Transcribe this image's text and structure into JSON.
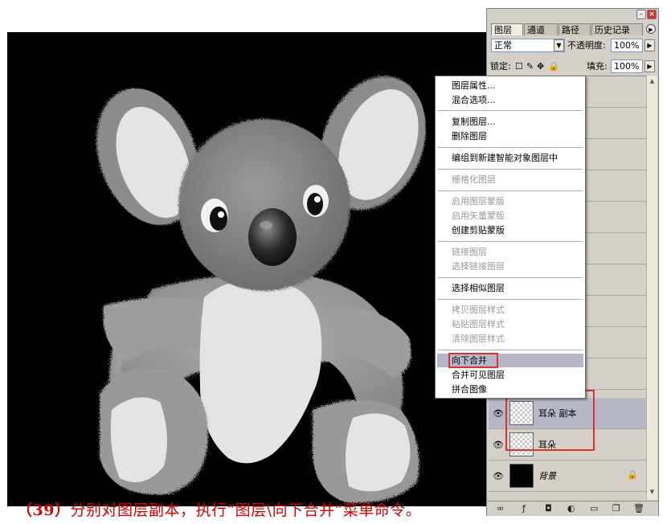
{
  "panel": {
    "tabs": [
      "图层",
      "通道",
      "路径",
      "历史记录"
    ],
    "blend_mode": "正常",
    "opacity_label": "不透明度:",
    "opacity_value": "100%",
    "lock_label": "锁定:",
    "fill_label": "填充:",
    "fill_value": "100%",
    "layers": [
      {
        "name": "耳朵 副本",
        "visible": true,
        "selected": true
      },
      {
        "name": "耳朵",
        "visible": true,
        "selected": false
      },
      {
        "name": "背景",
        "visible": true,
        "selected": false,
        "locked": true
      }
    ]
  },
  "context_menu": {
    "items": [
      {
        "label": "图层属性...",
        "enabled": true
      },
      {
        "label": "混合选项...",
        "enabled": true
      },
      {
        "label": "复制图层...",
        "enabled": true
      },
      {
        "label": "删除图层",
        "enabled": true
      },
      {
        "label": "编组到新建智能对象图层中",
        "enabled": true
      },
      {
        "label": "栅格化图层",
        "enabled": false
      },
      {
        "label": "启用图层蒙版",
        "enabled": false
      },
      {
        "label": "启用矢量蒙版",
        "enabled": false
      },
      {
        "label": "创建剪贴蒙版",
        "enabled": true
      },
      {
        "label": "链接图层",
        "enabled": false
      },
      {
        "label": "选择链接图层",
        "enabled": false
      },
      {
        "label": "选择相似图层",
        "enabled": true
      },
      {
        "label": "拷贝图层样式",
        "enabled": false
      },
      {
        "label": "粘贴图层样式",
        "enabled": false
      },
      {
        "label": "清除图层样式",
        "enabled": false
      },
      {
        "label": "向下合并",
        "enabled": true,
        "highlighted": true
      },
      {
        "label": "合并可见图层",
        "enabled": true
      },
      {
        "label": "拼合图像",
        "enabled": true
      }
    ]
  },
  "caption": {
    "step": "（39）",
    "text": "分别对图层副本，执行“图层\\向下合并”菜单命令。"
  },
  "colors": {
    "canvas": "#000000",
    "caption": "#d40000",
    "highlight": "#e03030",
    "selection": "#b6b8c8"
  }
}
